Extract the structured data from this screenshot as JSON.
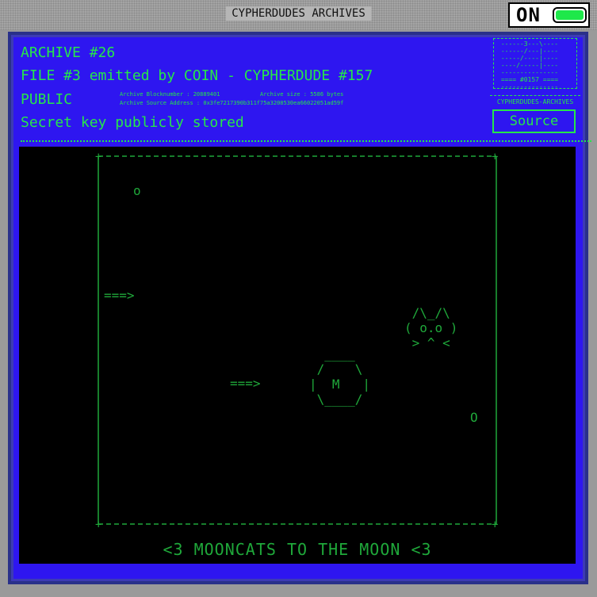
{
  "window": {
    "title": "CYPHERDUDES ARCHIVES",
    "power_label": "ON"
  },
  "colors": {
    "panel": "#2e16f0",
    "text": "#26e64a",
    "screen": "#000000",
    "ascii": "#1fa83a",
    "power_on": "#1ee84a"
  },
  "header": {
    "archive": "ARCHIVE #26",
    "file": "FILE #3 emitted by COIN - CYPHERDUDE #157",
    "visibility": "PUBLIC",
    "status": "Secret key publicly stored",
    "blocknumber": "Archive Blocknumber : 20889401",
    "size": "Archive size : 5586 bytes",
    "source_address": "Archive Source Address : 0x3fe7217390b311f75a3208530ea66022051ad59f"
  },
  "logo": {
    "art": " ------3---\\----\n ------/---|----\n -----/----|----\n ----/-----|----\n ---------------\n ==== #0157 ====\n ---------------",
    "caption": "CYPHERDUDES-ARCHIVES"
  },
  "source_button": "Source",
  "scene": {
    "star_small": "o",
    "arrow_left": "===>",
    "arrow_mid": "===>",
    "cat": " /\\_/\\\n( o.o )\n > ^ <",
    "moon": "  ____\n /    \\\n|  M   |\n \\____/",
    "planet": "O",
    "caption": "<3 MOONCATS TO THE MOON <3"
  }
}
